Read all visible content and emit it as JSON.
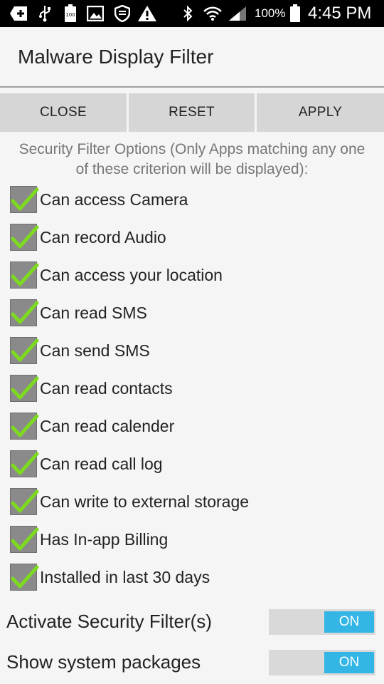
{
  "status_bar": {
    "icons_left": [
      "add-box-icon",
      "usb-icon",
      "battery-100-icon",
      "image-icon",
      "shield-icon",
      "warning-icon"
    ],
    "icons_right": [
      "bluetooth-icon",
      "wifi-icon",
      "signal-icon",
      "battery-icon"
    ],
    "battery_percent": "100%",
    "time": "4:45 PM"
  },
  "header": {
    "title": "Malware Display Filter"
  },
  "toolbar": {
    "close_label": "CLOSE",
    "reset_label": "RESET",
    "apply_label": "APPLY"
  },
  "filter": {
    "subtitle": "Security Filter Options (Only Apps matching any one of these criterion will be displayed):",
    "options": [
      {
        "label": "Can access Camera",
        "checked": true
      },
      {
        "label": "Can record Audio",
        "checked": true
      },
      {
        "label": "Can access your location",
        "checked": true
      },
      {
        "label": "Can read SMS",
        "checked": true
      },
      {
        "label": "Can send SMS",
        "checked": true
      },
      {
        "label": "Can read contacts",
        "checked": true
      },
      {
        "label": "Can read calender",
        "checked": true
      },
      {
        "label": "Can read call log",
        "checked": true
      },
      {
        "label": "Can write to external storage",
        "checked": true
      },
      {
        "label": "Has In-app Billing",
        "checked": true
      },
      {
        "label": "Installed in last 30 days",
        "checked": true
      }
    ]
  },
  "toggles": [
    {
      "label": "Activate Security Filter(s)",
      "state": "ON"
    },
    {
      "label": "Show system packages",
      "state": "ON"
    }
  ],
  "colors": {
    "accent": "#33b5e5",
    "check": "#7ddb1f",
    "checkbox_bg": "#8a8a8a",
    "button_bg": "#d6d6d6"
  }
}
